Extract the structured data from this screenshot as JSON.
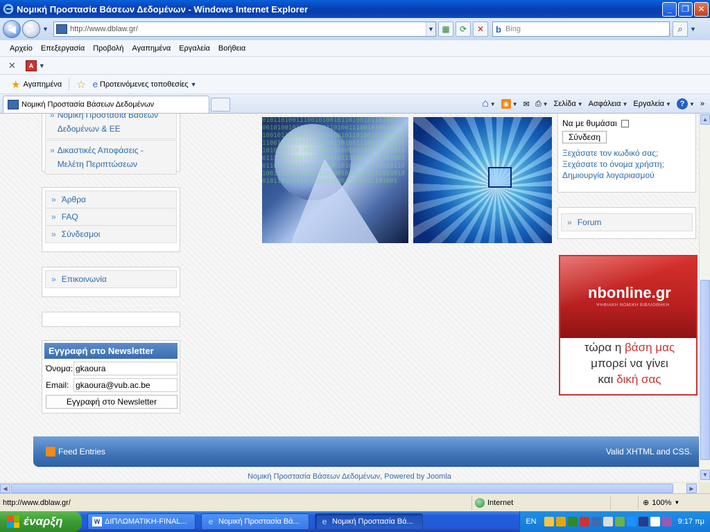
{
  "window": {
    "title": "Νομική Προστασία Βάσεων Δεδομένων - Windows Internet Explorer"
  },
  "addressbar": {
    "url": "http://www.dblaw.gr/",
    "search_placeholder": "Bing",
    "search_brand": "b"
  },
  "menubar": {
    "items": [
      "Αρχείο",
      "Επεξεργασία",
      "Προβολή",
      "Αγαπημένα",
      "Εργαλεία",
      "Βοήθεια"
    ]
  },
  "favbar": {
    "favorites_label": "Αγαπημένα",
    "suggested_label": "Προτεινόμενες τοποθεσίες"
  },
  "tabs": {
    "active_tab": "Νομική Προστασία Βάσεων Δεδομένων",
    "tools": {
      "page": "Σελίδα",
      "safety": "Ασφάλεια",
      "tools": "Εργαλεία",
      "help": "?"
    }
  },
  "site": {
    "sidebar_menu1": [
      {
        "label": "Νομική Προστασία Βάσεων Δεδομένων & ΕΕ"
      },
      {
        "label": "Δικαστικές Αποφάσεις - Μελέτη Περιπτώσεων"
      }
    ],
    "sidebar_menu2": [
      {
        "label": "Άρθρα"
      },
      {
        "label": "FAQ"
      },
      {
        "label": "Σύνδεσμοι"
      }
    ],
    "sidebar_menu3": [
      {
        "label": "Επικοινωνία"
      }
    ],
    "newsletter": {
      "title": "Εγγραφή στο Newsletter",
      "name_label": "Όνομα:",
      "name_value": "gkaoura",
      "email_label": "Email:",
      "email_value": "gkaoura@vub.ac.be",
      "submit": "Εγγραφή στο Newsletter"
    },
    "login": {
      "remember": "Να με θυμάσαι",
      "submit": "Σύνδεση",
      "forgot_password": "Ξεχάσατε τον κωδικό σας;",
      "forgot_username": "Ξεχάσατε το όνομα χρήστη;",
      "create_account": "Δημιουργία λογαριασμού"
    },
    "forum_link": "Forum",
    "ad": {
      "brand": "nbonline.gr",
      "brand_sub": "ΨΗΦΙΑΚΗ ΝΟΜΙΚΗ ΒΙΒΛΙΟΘΗΚΗ",
      "line1_a": "τώρα η ",
      "line1_b": "βάση μας",
      "line2": "μπορεί να γίνει",
      "line3_a": "και ",
      "line3_b": "δική σας"
    },
    "footer": {
      "feed": "Feed Entries",
      "valid": "Valid XHTML and CSS.",
      "credit": "Νομική Προστασία Βάσεων Δεδομένων, Powered by Joomla"
    }
  },
  "statusbar": {
    "text": "http://www.dblaw.gr/",
    "zone": "Internet",
    "zoom": "100%"
  },
  "taskbar": {
    "start": "έναρξη",
    "items": [
      {
        "label": "ΔΙΠΛΩΜΑΤΙΚΗ-FINAL...",
        "icon": "word"
      },
      {
        "label": "Νομική Προστασία Βά...",
        "icon": "ie"
      },
      {
        "label": "Νομική Προστασία Βά...",
        "icon": "ie"
      }
    ],
    "lang": "EN",
    "clock": "9:17 πμ"
  },
  "colors": {
    "link": "#2c6aa8",
    "titlebar": "#0a3ea8",
    "ad_red": "#c33333"
  }
}
